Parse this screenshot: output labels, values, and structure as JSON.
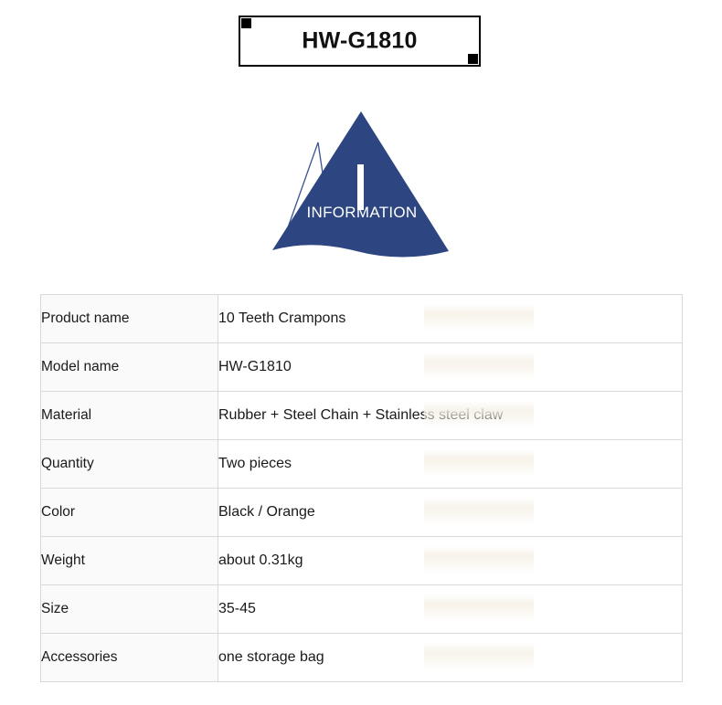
{
  "title_banner": {
    "text": "HW-G1810"
  },
  "info_graphic": {
    "letter": "I",
    "label": "INFORMATION",
    "triangle_color": "#2d4580",
    "outline_color": "#3a5490"
  },
  "spec_table": {
    "rows": [
      {
        "label": "Product name",
        "value": "10 Teeth Crampons"
      },
      {
        "label": "Model name",
        "value": "HW-G1810"
      },
      {
        "label": "Material",
        "value": "Rubber + Steel Chain + Stainless steel claw"
      },
      {
        "label": "Quantity",
        "value": "Two pieces"
      },
      {
        "label": "Color",
        "value": "Black / Orange"
      },
      {
        "label": "Weight",
        "value": "about 0.31kg"
      },
      {
        "label": "Size",
        "value": "35-45"
      },
      {
        "label": "Accessories",
        "value": "one storage bag"
      }
    ]
  }
}
